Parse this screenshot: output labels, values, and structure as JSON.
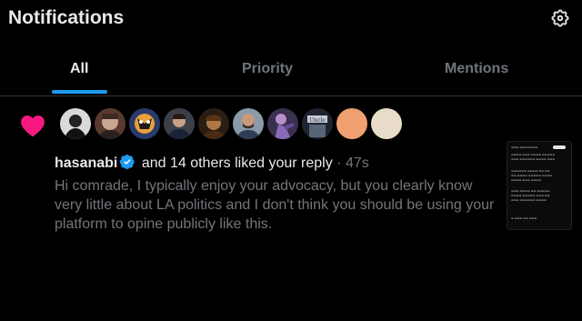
{
  "header": {
    "title": "Notifications",
    "settings_icon": "gear-icon"
  },
  "tabs": [
    {
      "label": "All",
      "active": true
    },
    {
      "label": "Priority",
      "active": false
    },
    {
      "label": "Mentions",
      "active": false
    }
  ],
  "colors": {
    "accent": "#1d9bf0",
    "like": "#f91880",
    "text_primary": "#e7e9ea",
    "text_secondary": "#71767b",
    "background": "#000000"
  },
  "notification": {
    "type_icon": "heart-icon",
    "avatars": [
      {
        "name": "avatar-1",
        "color": "#cfcfcf"
      },
      {
        "name": "avatar-2",
        "color": "#8a4a3a"
      },
      {
        "name": "avatar-3",
        "color": "#e8a13a"
      },
      {
        "name": "avatar-4",
        "color": "#3a3a4a"
      },
      {
        "name": "avatar-5",
        "color": "#6a4a2a"
      },
      {
        "name": "avatar-6",
        "color": "#5a6a7a"
      },
      {
        "name": "avatar-7",
        "color": "#7a5aa0"
      },
      {
        "name": "avatar-8",
        "color": "#3a3a3a"
      },
      {
        "name": "avatar-9",
        "color": "#f0a070"
      },
      {
        "name": "avatar-10",
        "color": "#e8dcc8"
      }
    ],
    "username": "hasanabi",
    "action_text": "and 14 others liked your reply",
    "separator": "·",
    "time": "47s",
    "reply_text": "Hi comrade, I typically enjoy your advocacy, but you clearly know very little about LA politics and I don't think you should be using your platform to opine publicly like this."
  }
}
